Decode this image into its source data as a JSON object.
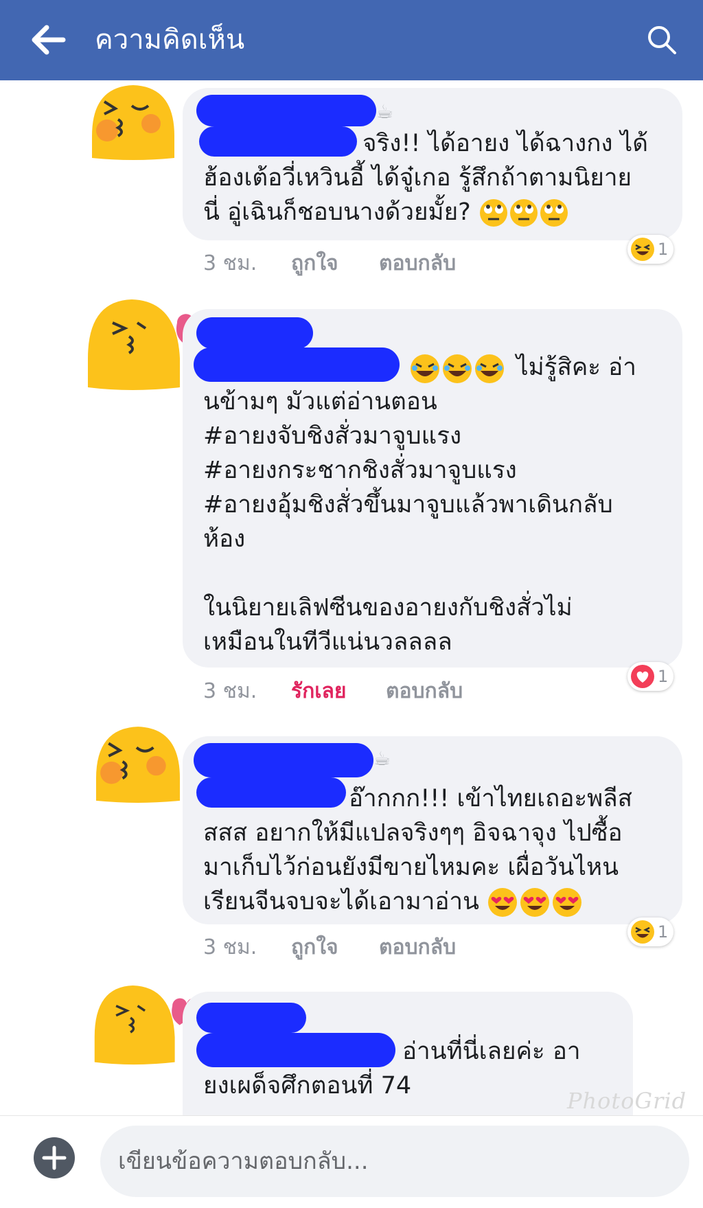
{
  "header": {
    "title": "ความคิดเห็น",
    "back_icon": "arrow-left-icon",
    "search_icon": "search-icon",
    "color": "#4267b2"
  },
  "comments": [
    {
      "avatar_icon": "kissing-face-blush-icon",
      "text_lines": [
        "จริง!! ได้อายง ได้ฉางกง ได้",
        "ฮ้องเต้อวี่เหวินอี้ ได้จู๋เกอ รู้สึกถ้าตามนิยาย",
        "นี่ อู่เฉินก็ชอบนางด้วยมั้ย?"
      ],
      "inline_emoji": "eye-roll-emoji x3",
      "time": "3 ชม.",
      "like": "ถูกใจ",
      "reply": "ตอบกลับ",
      "reaction_icon": "laughing-reaction-icon",
      "reaction_count": "1"
    },
    {
      "avatar_icon": "kissing-face-heart-icon",
      "first_line": "ไม่รู้สิคะ อ่า",
      "inline_emoji": "rofl-emoji x3",
      "text_lines": [
        "นข้ามๆ มัวแต่อ่านตอน",
        "#อายงจับชิงสั่วมาจูบแรง",
        "#อายงกระชากชิงสั่วมาจูบแรง",
        "#อายงอุ้มชิงสั่วขึ้นมาจูบแล้วพาเดินกลับ",
        "ห้อง",
        "",
        "ในนิยายเลิฟซีนของอายงกับชิงสั่วไม่",
        "เหมือนในทีวีแน่นวลลลล"
      ],
      "time": "3 ชม.",
      "like": "รักเลย",
      "reply": "ตอบกลับ",
      "reaction_icon": "heart-reaction-icon",
      "reaction_count": "1"
    },
    {
      "avatar_icon": "kissing-face-blush-icon",
      "text_lines": [
        "อ๊ากกก!!! เข้าไทยเถอะพลีส",
        "สสส อยากให้มีแปลจริงๆๆ อิจฉาจุง ไปซื้อ",
        "มาเก็บไว้ก่อนยังมีขายไหมคะ เผื่อวันไหน",
        "เรียนจีนจบจะได้เอามาอ่าน"
      ],
      "inline_emoji": "heart-eyes-emoji x3",
      "time": "3 ชม.",
      "like": "ถูกใจ",
      "reply": "ตอบกลับ",
      "reaction_icon": "laughing-reaction-icon",
      "reaction_count": "1"
    },
    {
      "avatar_icon": "kissing-face-heart-icon",
      "text_lines": [
        "อ่านที่นี่เลยค่ะ อา",
        "ยงเผด็จศึกตอนที่ 74"
      ]
    }
  ],
  "composer": {
    "placeholder": "เขียนข้อความตอบกลับ...",
    "plus_icon": "plus-circle-icon"
  },
  "watermark": "PhotoGrid"
}
